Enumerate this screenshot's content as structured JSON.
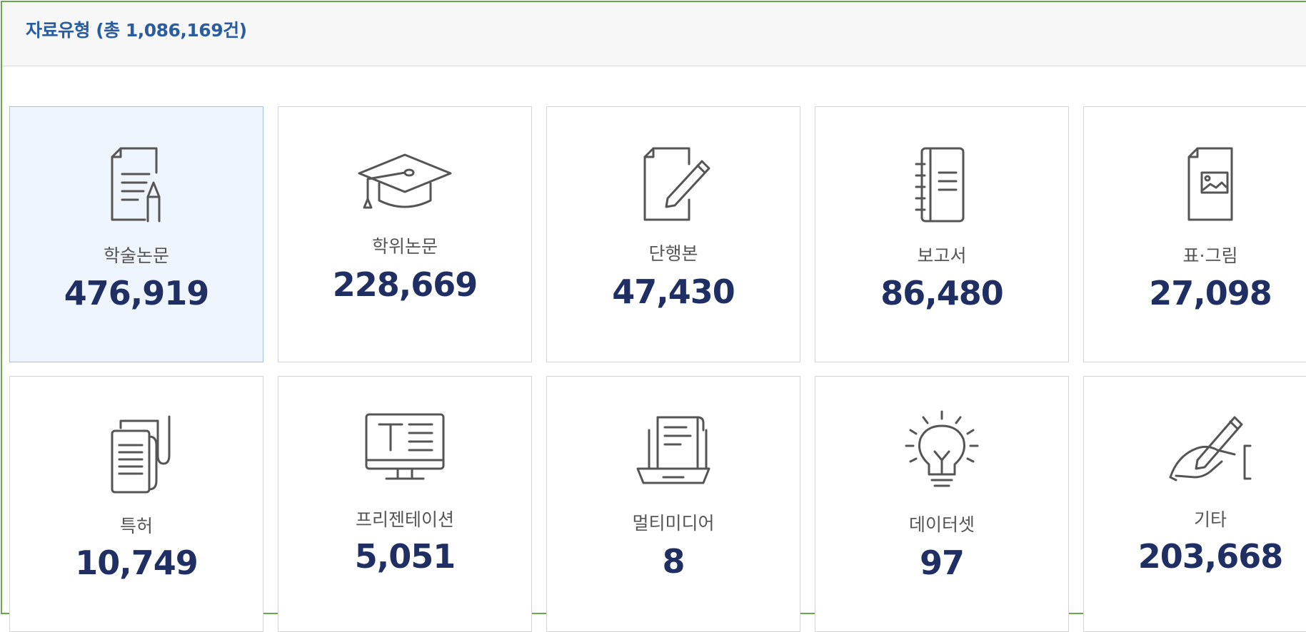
{
  "section": {
    "title": "자료유형 (총 1,086,169건)"
  },
  "items": [
    {
      "label": "학술논문",
      "count": "476,919",
      "icon": "document-pencil-icon",
      "selected": true
    },
    {
      "label": "학위논문",
      "count": "228,669",
      "icon": "graduation-cap-icon"
    },
    {
      "label": "단행본",
      "count": "47,430",
      "icon": "page-pen-icon"
    },
    {
      "label": "보고서",
      "count": "86,480",
      "icon": "notebook-icon"
    },
    {
      "label": "표·그림",
      "count": "27,098",
      "icon": "document-image-icon"
    },
    {
      "label": "특허",
      "count": "10,749",
      "icon": "scroll-document-icon"
    },
    {
      "label": "프리젠테이션",
      "count": "5,051",
      "icon": "presentation-monitor-icon"
    },
    {
      "label": "멀티미디어",
      "count": "8",
      "icon": "laptop-document-icon"
    },
    {
      "label": "데이터셋",
      "count": "97",
      "icon": "lightbulb-icon"
    },
    {
      "label": "기타",
      "count": "203,668",
      "icon": "hand-pen-icon"
    }
  ],
  "colors": {
    "accent": "#2a5d9f",
    "count": "#1f2f63",
    "selected_bg": "#eff5fc",
    "border_frame": "#6aa84f"
  }
}
